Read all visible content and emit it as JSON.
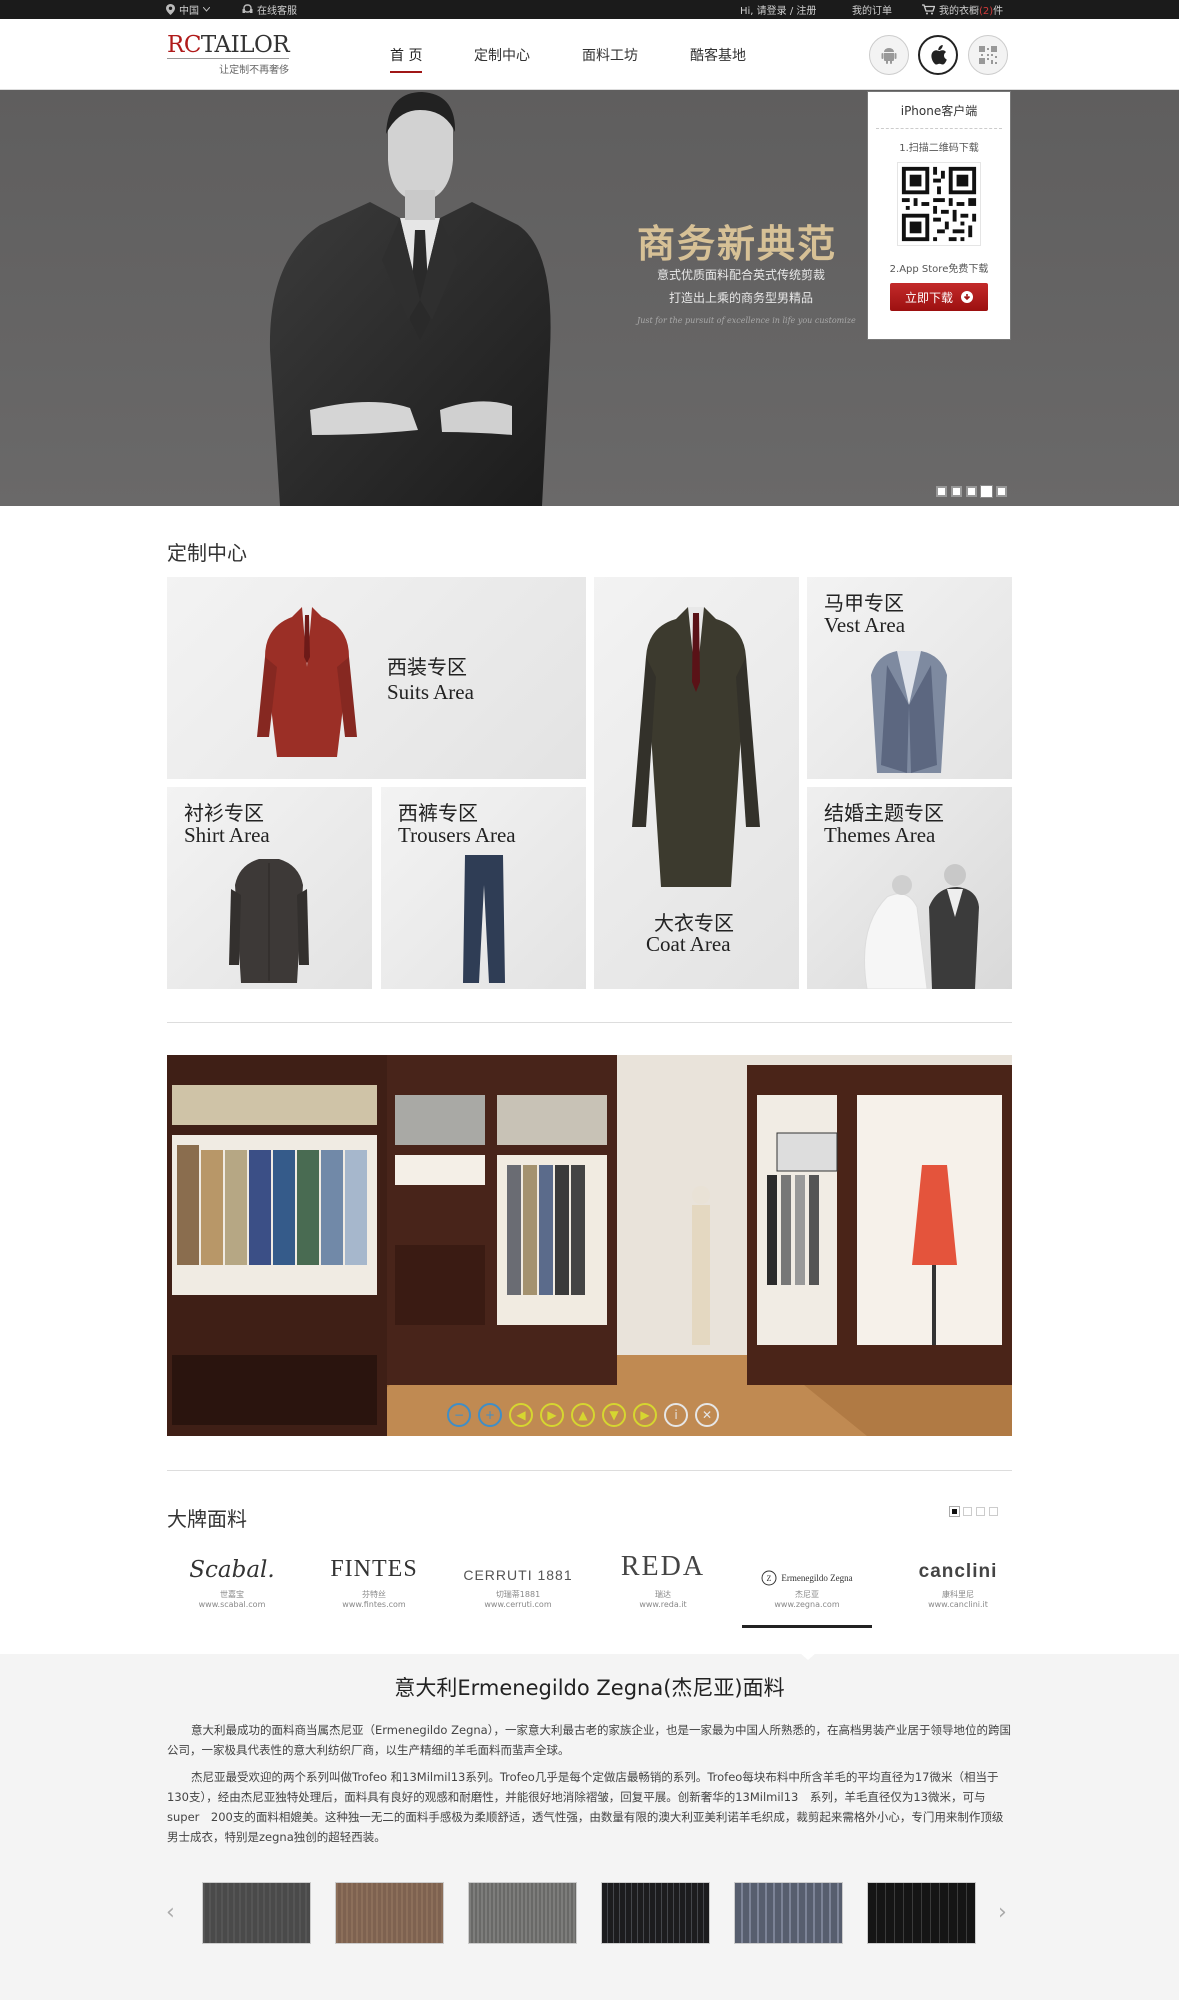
{
  "topbar": {
    "region": "中国",
    "service": "在线客服",
    "login": "Hi, 请登录 / 注册",
    "orders": "我的订单",
    "wardrobe_prefix": "我的衣橱",
    "wardrobe_count": "(2)",
    "wardrobe_suffix": "件"
  },
  "header": {
    "logo_rc": "RC",
    "logo_tailor": "TAILOR",
    "logo_tag": "让定制不再奢侈",
    "nav": [
      "首 页",
      "定制中心",
      "面料工坊",
      "酷客基地"
    ],
    "active_nav": 0
  },
  "app_popup": {
    "title": "iPhone客户端",
    "step1": "1.扫描二维码下载",
    "step2": "2.App Store免费下载",
    "download": "立即下载"
  },
  "banner": {
    "title": "商务新典范",
    "line1": "意式优质面料配合英式传统剪裁",
    "line2": "打造出上乘的商务型男精品",
    "motto": "Just for the pursuit of excellence in life you customize",
    "active_slide": 3,
    "slide_count": 5
  },
  "custom_center": {
    "title": "定制中心",
    "tiles": [
      {
        "cn": "西装专区",
        "en": "Suits Area"
      },
      {
        "cn": "马甲专区",
        "en": "Vest Area"
      },
      {
        "cn": "衬衫专区",
        "en": "Shirt Area"
      },
      {
        "cn": "西裤专区",
        "en": "Trousers Area"
      },
      {
        "cn": "大衣专区",
        "en": "Coat Area"
      },
      {
        "cn": "结婚主题专区",
        "en": "Themes Area"
      }
    ]
  },
  "brands_section": {
    "title": "大牌面料",
    "active_page": 0,
    "brands": [
      {
        "logo": "Scabal.",
        "name": "世嘉宝",
        "url": "www.scabal.com"
      },
      {
        "logo": "FINTES",
        "name": "芬特丝",
        "url": "www.fintes.com"
      },
      {
        "logo": "CERRUTI 1881",
        "name": "切瑞蒂1881",
        "url": "www.cerruti.com"
      },
      {
        "logo": "REDA",
        "name": "瑞达",
        "url": "www.reda.it"
      },
      {
        "logo": "Ermenegildo Zegna",
        "name": "杰尼亚",
        "url": "www.zegna.com"
      },
      {
        "logo": "canclini",
        "name": "康科里尼",
        "url": "www.canclini.it"
      }
    ],
    "active_brand": 4
  },
  "detail": {
    "title": "意大利Ermenegildo Zegna(杰尼亚)面料",
    "para1": "意大利最成功的面料商当属杰尼亚（Ermenegildo Zegna），一家意大利最古老的家族企业，也是一家最为中国人所熟悉的，在高档男装产业居于领导地位的跨国公司，一家极具代表性的意大利纺织厂商，以生产精细的羊毛面料而蜚声全球。",
    "para2": "杰尼亚最受欢迎的两个系列叫做Trofeo 和13Milmil13系列。Trofeo几乎是每个定做店最畅销的系列。Trofeo每块布料中所含羊毛的平均直径为17微米（相当于130支），经由杰尼亚独特处理后，面料具有良好的观感和耐磨性，并能很好地消除褶皱，回复平展。创新奢华的13Milmil13　系列，羊毛直径仅为13微米，可与super　200支的面料相媲美。这种独一无二的面料手感极为柔顺舒适，透气性强，由数量有限的澳大利亚美利诺羊毛织成，裁剪起来需格外小心，专门用来制作顶级男士成衣，特别是zegna独创的超轻西装。"
  }
}
